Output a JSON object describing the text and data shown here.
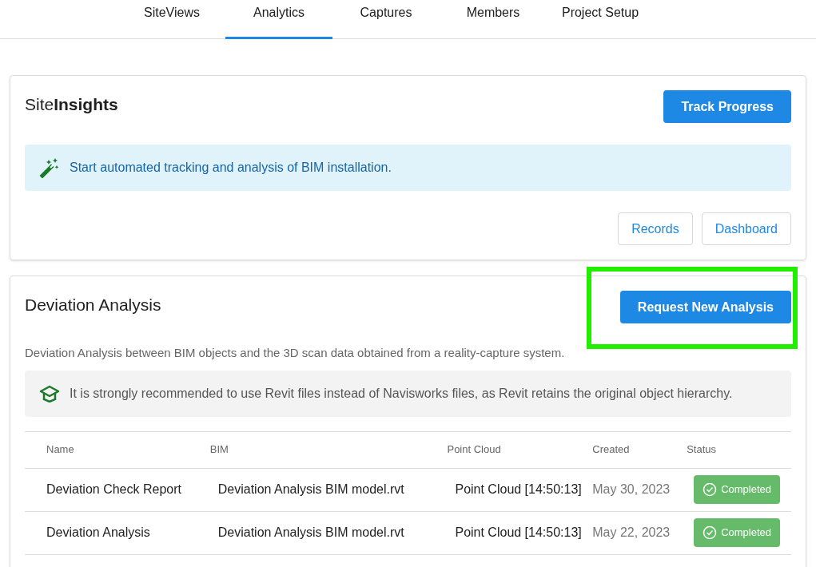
{
  "tabs": [
    {
      "label": "SiteViews",
      "selected": false
    },
    {
      "label": "Analytics",
      "selected": true
    },
    {
      "label": "Captures",
      "selected": false
    },
    {
      "label": "Members",
      "selected": false
    },
    {
      "label": "Project Setup",
      "selected": false
    }
  ],
  "insights": {
    "title": "Site**Insights**",
    "primary_button": "Track Progress",
    "notice": "Start automated tracking and analysis of BIM installation.",
    "buttons": [
      "Records",
      "Dashboard"
    ]
  },
  "deviation": {
    "title": "Deviation Analysis",
    "primary_button": "Request New Analysis",
    "highlighted": true,
    "description": "Deviation Analysis between BIM objects and the 3D scan data obtained from a reality-capture system.",
    "notice": "It is strongly recommended to use Revit files instead of Navisworks files, as Revit retains the original object hierarchy.",
    "table": {
      "columns": [
        "Name",
        "BIM",
        "Point Cloud",
        "Created",
        "Status"
      ],
      "rows": [
        {
          "name": "Deviation Check Report",
          "bim": "Deviation Analysis BIM model.rvt",
          "point_cloud": "Point Cloud [14:50:13]",
          "created": "May 30, 2023",
          "status": {
            "label": "Completed",
            "kind": "completed"
          }
        },
        {
          "name": "Deviation Analysis",
          "bim": "Deviation Analysis BIM model.rvt",
          "point_cloud": "Point Cloud [14:50:13]",
          "created": "May 22, 2023",
          "status": {
            "label": "Completed",
            "kind": "completed"
          }
        }
      ]
    }
  }
}
